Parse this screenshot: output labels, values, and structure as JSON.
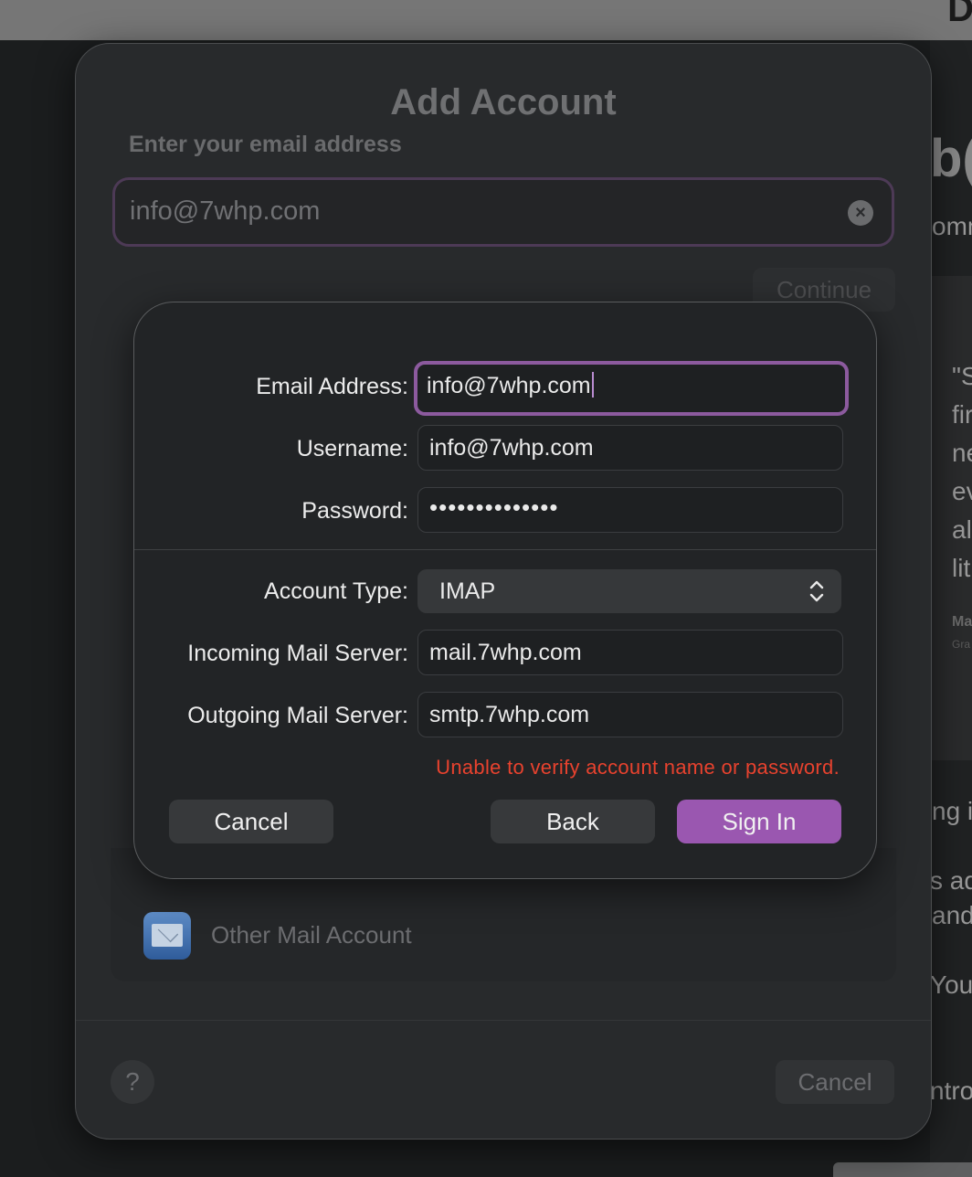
{
  "background": {
    "top_glyph": "D",
    "right_fragments": [
      "b(",
      "omm",
      "\"S",
      "fir",
      "ne",
      "ev",
      "al",
      "lit",
      "Ma",
      "Gra",
      "ng it",
      "s ad",
      "and",
      "You",
      "ntro"
    ]
  },
  "sheet": {
    "title": "Add Account",
    "subtitle": "Enter your email address",
    "email_value": "info@7whp.com",
    "clear_icon": "×",
    "continue_label": "Continue",
    "other_mail_label": "Other Mail Account",
    "help_label": "?",
    "cancel_label": "Cancel"
  },
  "dialog": {
    "email_label": "Email Address:",
    "email_value": "info@7whp.com",
    "username_label": "Username:",
    "username_value": "info@7whp.com",
    "password_label": "Password:",
    "password_value": "••••••••••••••",
    "account_type_label": "Account Type:",
    "account_type_value": "IMAP",
    "incoming_label": "Incoming Mail Server:",
    "incoming_value": "mail.7whp.com",
    "outgoing_label": "Outgoing Mail Server:",
    "outgoing_value": "smtp.7whp.com",
    "error": "Unable to verify account name or password.",
    "cancel_label": "Cancel",
    "back_label": "Back",
    "signin_label": "Sign In"
  },
  "colors": {
    "accent": "#9a57b0",
    "focus_ring": "#8c5a9e",
    "error": "#e8422e"
  }
}
